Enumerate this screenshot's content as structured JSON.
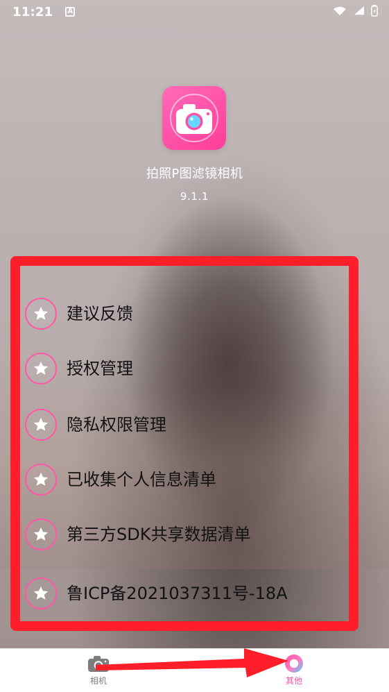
{
  "status_bar": {
    "time": "11:21",
    "notification_badge": "A",
    "icons": [
      "wifi-icon",
      "signal-icon",
      "battery-icon"
    ]
  },
  "app": {
    "icon": "camera-icon",
    "title": "拍照P图滤镜相机",
    "version": "9.1.1"
  },
  "menu": {
    "items": [
      {
        "label": "建议反馈",
        "icon": "star-icon"
      },
      {
        "label": "授权管理",
        "icon": "star-icon"
      },
      {
        "label": "隐私权限管理",
        "icon": "star-icon"
      },
      {
        "label": "已收集个人信息清单",
        "icon": "star-icon"
      },
      {
        "label": "第三方SDK共享数据清单",
        "icon": "star-icon"
      },
      {
        "label": "鲁ICP备2021037311号-18A",
        "icon": "star-icon"
      }
    ]
  },
  "tab_bar": {
    "tabs": [
      {
        "label": "相机",
        "icon": "camera-icon",
        "active": false
      },
      {
        "label": "其他",
        "icon": "ring-icon",
        "active": true
      }
    ]
  },
  "colors": {
    "accent_pink": "#ff4fa6",
    "highlight_red": "#ff1e2a",
    "text_white": "#ffffff",
    "text_dark": "#121212",
    "tab_inactive": "#7d7d7d"
  }
}
